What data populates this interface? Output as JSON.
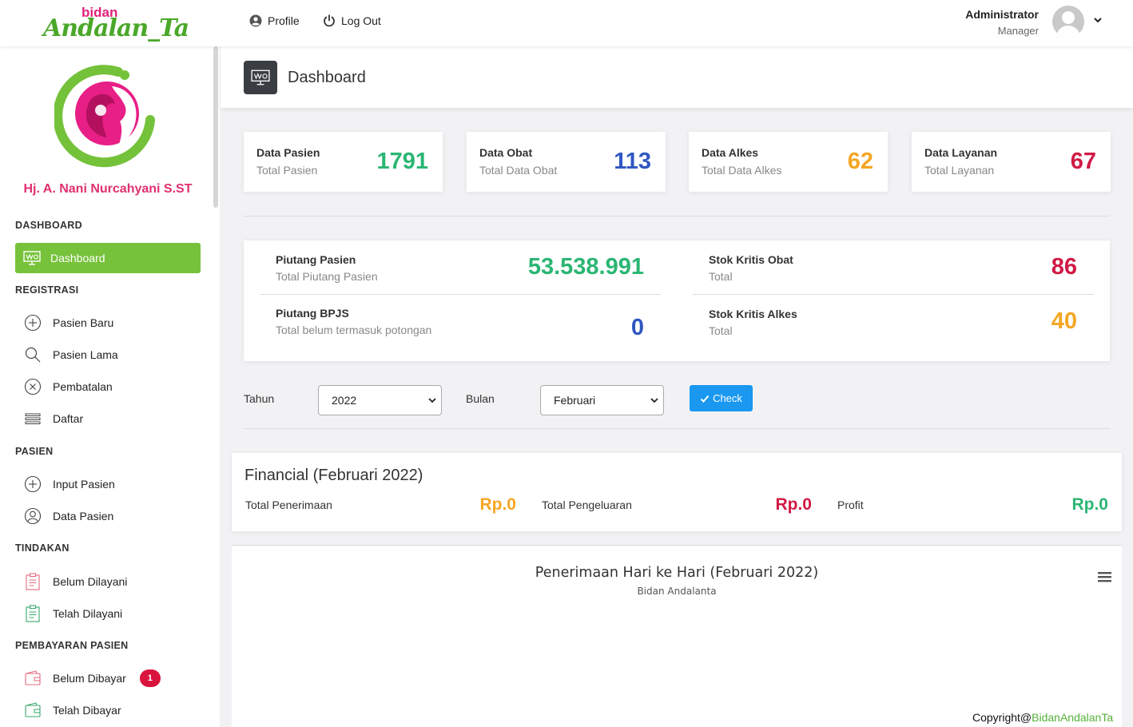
{
  "brand": {
    "logo_small": "bidan",
    "logo_big": "Andalan_Ta"
  },
  "topnav": {
    "profile_label": "Profile",
    "logout_label": "Log Out"
  },
  "user": {
    "name": "Administrator",
    "role": "Manager"
  },
  "sidebar": {
    "clinic_name": "Hj. A. Nani Nurcahyani S.ST",
    "sections": {
      "dashboard": "DASHBOARD",
      "registrasi": "REGISTRASI",
      "pasien": "PASIEN",
      "tindakan": "TINDAKAN",
      "pembayaran": "PEMBAYARAN PASIEN"
    },
    "items": {
      "dashboard": "Dashboard",
      "pasien_baru": "Pasien Baru",
      "pasien_lama": "Pasien Lama",
      "pembatalan": "Pembatalan",
      "daftar": "Daftar",
      "input_pasien": "Input Pasien",
      "data_pasien": "Data Pasien",
      "belum_dilayani": "Belum Dilayani",
      "telah_dilayani": "Telah Dilayani",
      "belum_dibayar": "Belum Dibayar",
      "belum_dibayar_badge": "1",
      "telah_dibayar": "Telah Dibayar"
    }
  },
  "header": {
    "title": "Dashboard"
  },
  "stats": [
    {
      "title": "Data Pasien",
      "subtitle": "Total Pasien",
      "value": "1791",
      "color": "#2bb673"
    },
    {
      "title": "Data Obat",
      "subtitle": "Total Data Obat",
      "value": "113",
      "color": "#2f57c2"
    },
    {
      "title": "Data Alkes",
      "subtitle": "Total Data Alkes",
      "value": "62",
      "color": "#f5a623"
    },
    {
      "title": "Data Layanan",
      "subtitle": "Total Layanan",
      "value": "67",
      "color": "#d11a45"
    }
  ],
  "summary": {
    "piutang_pasien": {
      "title": "Piutang Pasien",
      "subtitle": "Total Piutang Pasien",
      "value": "53.538.991"
    },
    "piutang_bpjs": {
      "title": "Piutang BPJS",
      "subtitle": "Total belum termasuk potongan",
      "value": "0"
    },
    "stok_obat": {
      "title": "Stok Kritis Obat",
      "subtitle": "Total",
      "value": "86"
    },
    "stok_alkes": {
      "title": "Stok Kritis Alkes",
      "subtitle": "Total",
      "value": "40"
    }
  },
  "filter": {
    "tahun_label": "Tahun",
    "tahun_value": "2022",
    "bulan_label": "Bulan",
    "bulan_value": "Februari",
    "check_label": "Check"
  },
  "financial": {
    "title": "Financial (Februari 2022)",
    "penerimaan_label": "Total Penerimaan",
    "penerimaan_value": "Rp.0",
    "pengeluaran_label": "Total Pengeluaran",
    "pengeluaran_value": "Rp.0",
    "profit_label": "Profit",
    "profit_value": "Rp.0"
  },
  "chart": {
    "title": "Penerimaan Hari ke Hari (Februari 2022)",
    "subtitle": "Bidan Andalanta"
  },
  "footer": {
    "prefix": "Copyright@",
    "link": "BidanAndalanTa"
  },
  "colors": {
    "accent_green": "#77c23b",
    "value_green": "#2bb673",
    "value_blue": "#2f57c2",
    "value_orange": "#f5a623",
    "value_red": "#d11a45",
    "button_blue": "#1a98f0"
  }
}
